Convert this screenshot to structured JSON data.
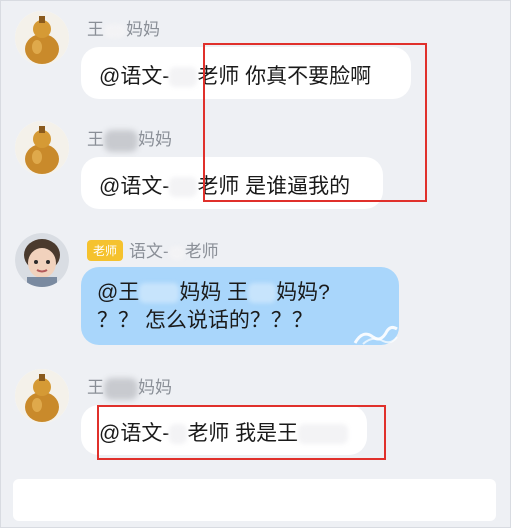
{
  "messages": [
    {
      "sender_prefix": "王",
      "sender_suffix": "妈妈",
      "mention": "@语文-",
      "text_after": "老师 你真不要脸啊"
    },
    {
      "sender_prefix": "王",
      "sender_suffix": "妈妈",
      "mention": "@语文-",
      "text_after": "老师 是谁逼我的"
    },
    {
      "badge": "老师",
      "sender_prefix": "语文-",
      "sender_suffix": "老师",
      "line1_a": "@王",
      "line1_b": "妈妈 王",
      "line1_c": "妈妈?",
      "line2": "？？ 怎么说话的？？？"
    },
    {
      "sender_prefix": "王",
      "sender_suffix": "妈妈",
      "mention": "@语文-",
      "text_after": "老师 我是王"
    }
  ],
  "colors": {
    "highlight_box": "#e0302b",
    "teacher_bubble": "#a9d6fb",
    "badge": "#f5c22e",
    "background": "#eef0f4"
  },
  "icons": {
    "parent_avatar": "gold-gourd-avatar",
    "teacher_avatar": "child-photo-avatar",
    "bubble_decoration": "wave-decoration"
  },
  "input": {
    "placeholder": ""
  }
}
